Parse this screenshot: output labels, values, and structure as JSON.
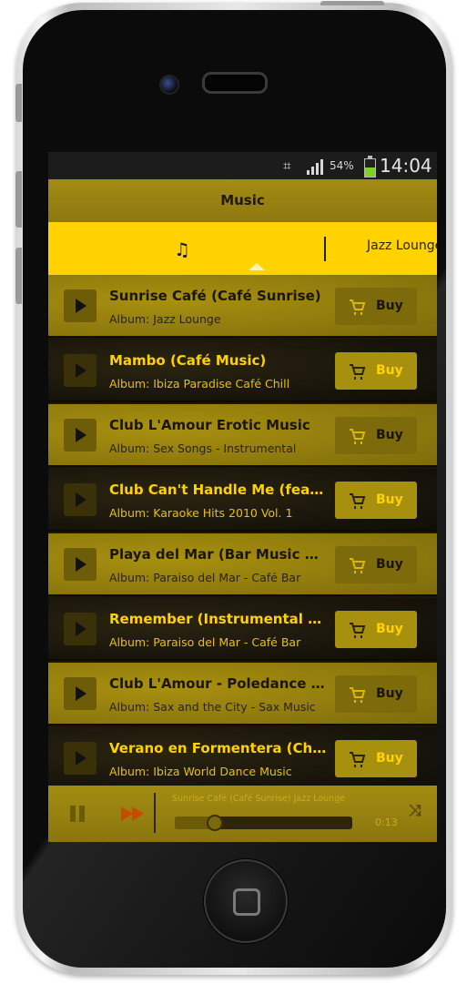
{
  "status_bar": {
    "battery": "54%",
    "time": "14:04",
    "battery_level": 0.54
  },
  "action_bar": {
    "title": "Music"
  },
  "tabs": {
    "music_icon": "music-note-icon",
    "album_tab_label": "Jazz Lounge"
  },
  "songs": [
    {
      "title": "Sunrise Café (Café Sunrise)",
      "album": "Album: Jazz Lounge",
      "buy_label": "Buy"
    },
    {
      "title": "Mambo (Café Music)",
      "album": "Album: Ibiza Paradise Café Chill",
      "buy_label": "Buy"
    },
    {
      "title": "Club L'Amour Erotic Music",
      "album": "Album: Sex Songs - Instrumental",
      "buy_label": "Buy"
    },
    {
      "title": "Club Can't Handle Me (feat. Flo Rida)",
      "album": "Album: Karaoke Hits 2010 Vol. 1",
      "buy_label": "Buy"
    },
    {
      "title": "Playa del Mar (Bar Music Café)",
      "album": "Album: Paraiso del Mar - Café Bar",
      "buy_label": "Buy"
    },
    {
      "title": "Remember (Instrumental Version)",
      "album": "Album: Paraiso del Mar - Café Bar",
      "buy_label": "Buy"
    },
    {
      "title": "Club L'Amour - Poledance Music",
      "album": "Album: Sax and the City - Sax Music",
      "buy_label": "Buy"
    },
    {
      "title": "Verano en Formentera (Chill Mix)",
      "album": "Album: Ibiza World Dance Music",
      "buy_label": "Buy"
    }
  ],
  "player": {
    "now_playing": "Sunrise Café (Café Sunrise)  Jazz Lounge",
    "elapsed": "0:13",
    "progress": 0.22
  },
  "colors": {
    "accent": "#ffd200",
    "gold": "#a38b14",
    "dark": "#16130a"
  }
}
